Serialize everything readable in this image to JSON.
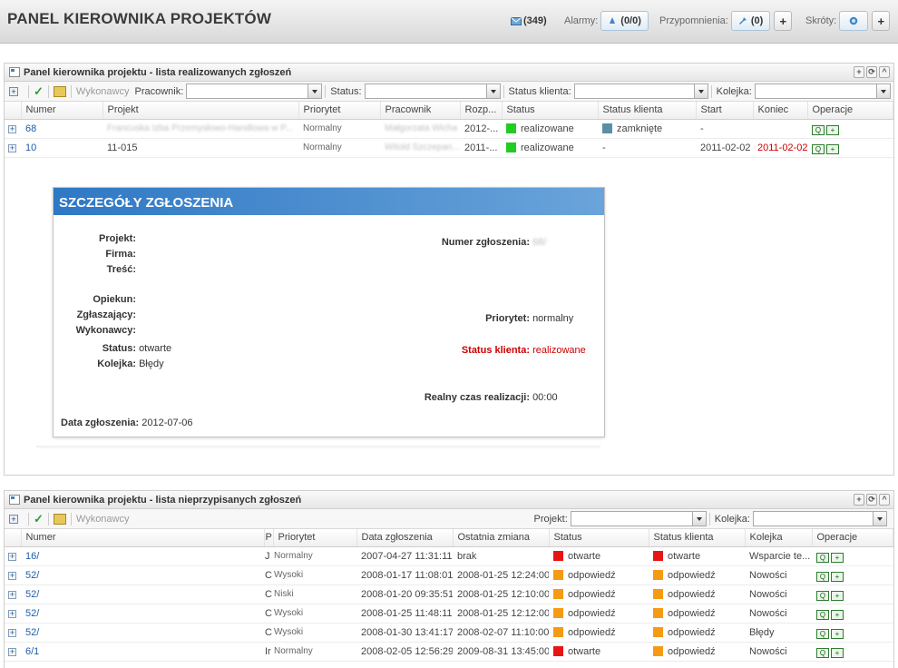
{
  "header": {
    "title": "PANEL KIEROWNIKA PROJEKTÓW",
    "messages": "(349)",
    "alarmy_label": "Alarmy:",
    "alarmy_value": "(0/0)",
    "przyp_label": "Przypomnienia:",
    "przyp_value": "(0)",
    "skroty_label": "Skróty:",
    "plus": "+"
  },
  "panel1": {
    "title": "Panel kierownika projektu - lista realizowanych zgłoszeń",
    "toolbar": {
      "wykonawcy": "Wykonawcy",
      "pracownik": "Pracownik:",
      "status": "Status:",
      "status_klienta": "Status klienta:",
      "kolejka": "Kolejka:"
    },
    "columns": [
      "Numer",
      "Projekt",
      "Priorytet",
      "Pracownik",
      "Rozp...",
      "Status",
      "Status klienta",
      "Start",
      "Koniec",
      "Operacje"
    ],
    "rows": [
      {
        "numer": "68",
        "projekt": "Francuska Izba Przemysłowo-Handlowa w P...",
        "priorytet": "Normalny",
        "pracownik": "Małgorzata Wicha",
        "rozp": "2012-...",
        "status": "realizowane",
        "status_color": "#22cc22",
        "status_klienta": "zamknięte",
        "sk_color": "#5a8fa8",
        "start": "-",
        "koniec": ""
      },
      {
        "numer": "10",
        "projekt": "11-015",
        "priorytet": "Normalny",
        "pracownik": "Witold Szczepan...",
        "rozp": "2011-...",
        "status": "realizowane",
        "status_color": "#22cc22",
        "status_klienta": "-",
        "sk_color": "",
        "start": "2011-02-02",
        "koniec": "2011-02-02"
      }
    ]
  },
  "detail": {
    "title": "SZCZEGÓŁY ZGŁOSZENIA",
    "projekt": "Projekt:",
    "firma": "Firma:",
    "tresc": "Treść:",
    "opiekun": "Opiekun:",
    "zglaszajacy": "Zgłaszający:",
    "wykonawcy": "Wykonawcy:",
    "status_label": "Status:",
    "status_value": "otwarte",
    "kolejka_label": "Kolejka:",
    "kolejka_value": "Błędy",
    "numer_label": "Numer zgłoszenia:",
    "numer_value": "68/",
    "priorytet_label": "Priorytet:",
    "priorytet_value": "normalny",
    "sk_label": "Status klienta:",
    "sk_value": "realizowane",
    "czas_label": "Realny czas realizacji:",
    "czas_value": "00:00",
    "data_label": "Data zgłoszenia:",
    "data_value": "2012-07-06"
  },
  "panel2": {
    "title": "Panel kierownika projektu - lista nieprzypisanych zgłoszeń",
    "toolbar": {
      "wykonawcy": "Wykonawcy",
      "projekt": "Projekt:",
      "kolejka": "Kolejka:"
    },
    "columns": [
      "Numer",
      "P",
      "Priorytet",
      "Data zgłoszenia",
      "Ostatnia zmiana",
      "Status",
      "Status klienta",
      "Kolejka",
      "Operacje"
    ],
    "rows": [
      {
        "numer": "16/",
        "p": "J",
        "priorytet": "Normalny",
        "data": "2007-04-27 11:31:11",
        "zmiana": "brak",
        "status": "otwarte",
        "s_color": "#e81414",
        "sk": "otwarte",
        "sk_color": "#e81414",
        "kolejka": "Wsparcie te..."
      },
      {
        "numer": "52/",
        "p": "C",
        "priorytet": "Wysoki",
        "data": "2008-01-17 11:08:01",
        "zmiana": "2008-01-25 12:24:00",
        "status": "odpowiedź",
        "s_color": "#f59a14",
        "sk": "odpowiedź",
        "sk_color": "#f59a14",
        "kolejka": "Nowości"
      },
      {
        "numer": "52/",
        "p": "C",
        "priorytet": "Niski",
        "data": "2008-01-20 09:35:51",
        "zmiana": "2008-01-25 12:10:00",
        "status": "odpowiedź",
        "s_color": "#f59a14",
        "sk": "odpowiedź",
        "sk_color": "#f59a14",
        "kolejka": "Nowości"
      },
      {
        "numer": "52/",
        "p": "C",
        "priorytet": "Wysoki",
        "data": "2008-01-25 11:48:11",
        "zmiana": "2008-01-25 12:12:00",
        "status": "odpowiedź",
        "s_color": "#f59a14",
        "sk": "odpowiedź",
        "sk_color": "#f59a14",
        "kolejka": "Nowości"
      },
      {
        "numer": "52/",
        "p": "C",
        "priorytet": "Wysoki",
        "data": "2008-01-30 13:41:17",
        "zmiana": "2008-02-07 11:10:00",
        "status": "odpowiedź",
        "s_color": "#f59a14",
        "sk": "odpowiedź",
        "sk_color": "#f59a14",
        "kolejka": "Błędy"
      },
      {
        "numer": "6/1",
        "p": "Ir",
        "priorytet": "Normalny",
        "data": "2008-02-05 12:56:29",
        "zmiana": "2009-08-31 13:45:00",
        "status": "otwarte",
        "s_color": "#e81414",
        "sk": "odpowiedź",
        "sk_color": "#f59a14",
        "kolejka": "Nowości"
      }
    ]
  }
}
